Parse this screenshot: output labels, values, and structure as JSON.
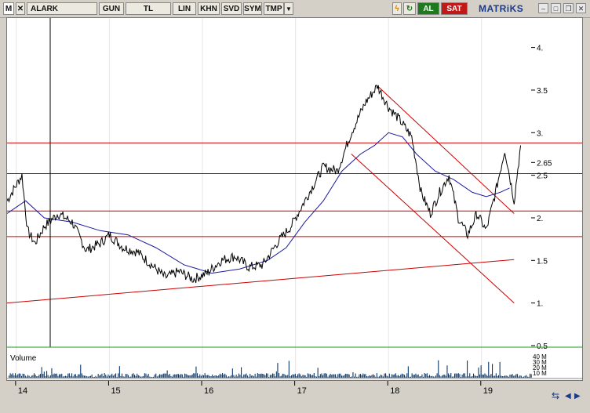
{
  "toolbar": {
    "m_label": "M",
    "symbol": "ALARK",
    "period": "GUN",
    "currency": "TL",
    "scale": "LIN",
    "khn": "KHN",
    "svd": "SVD",
    "sym": "SYM",
    "tmp": "TMP",
    "buy": "AL",
    "sell": "SAT",
    "logo": "MATRiKS"
  },
  "colors": {
    "price": "#000000",
    "moving_average": "#1a1aa0",
    "trendline": "#cc0000",
    "volume": "#0b3a6e",
    "buy": "#1f7a1f",
    "sell": "#c21818"
  },
  "chart_data": {
    "type": "line",
    "title": "",
    "y_ticks": [
      4,
      3.5,
      3,
      2.65,
      2.5,
      2,
      1.5,
      1,
      0.5
    ],
    "y_tick_labels": [
      "4.",
      "3.5",
      "3.",
      "2.65",
      "2.5",
      "2.",
      "1.5",
      "1.",
      "0.5"
    ],
    "ylim": [
      0.5,
      4.3
    ],
    "x_ticks": [
      "14",
      "15",
      "16",
      "17",
      "18",
      "19"
    ],
    "xlim": [
      2013.9,
      2019.55
    ],
    "price_points": [
      [
        2013.9,
        2.2
      ],
      [
        2013.98,
        2.35
      ],
      [
        2014.06,
        2.5
      ],
      [
        2014.12,
        1.85
      ],
      [
        2014.2,
        1.7
      ],
      [
        2014.3,
        1.9
      ],
      [
        2014.45,
        2.05
      ],
      [
        2014.6,
        1.95
      ],
      [
        2014.75,
        1.62
      ],
      [
        2014.9,
        1.7
      ],
      [
        2015.0,
        1.8
      ],
      [
        2015.15,
        1.65
      ],
      [
        2015.3,
        1.6
      ],
      [
        2015.45,
        1.45
      ],
      [
        2015.6,
        1.3
      ],
      [
        2015.75,
        1.37
      ],
      [
        2015.9,
        1.28
      ],
      [
        2016.05,
        1.35
      ],
      [
        2016.2,
        1.5
      ],
      [
        2016.35,
        1.55
      ],
      [
        2016.5,
        1.42
      ],
      [
        2016.65,
        1.45
      ],
      [
        2016.8,
        1.7
      ],
      [
        2016.95,
        1.9
      ],
      [
        2017.05,
        2.1
      ],
      [
        2017.15,
        2.3
      ],
      [
        2017.3,
        2.6
      ],
      [
        2017.45,
        2.55
      ],
      [
        2017.6,
        3.0
      ],
      [
        2017.75,
        3.35
      ],
      [
        2017.88,
        3.55
      ],
      [
        2018.0,
        3.3
      ],
      [
        2018.12,
        3.15
      ],
      [
        2018.25,
        2.95
      ],
      [
        2018.35,
        2.3
      ],
      [
        2018.45,
        2.05
      ],
      [
        2018.55,
        2.3
      ],
      [
        2018.65,
        2.5
      ],
      [
        2018.75,
        2.0
      ],
      [
        2018.85,
        1.8
      ],
      [
        2018.95,
        2.05
      ],
      [
        2019.05,
        1.85
      ],
      [
        2019.15,
        2.3
      ],
      [
        2019.25,
        2.8
      ],
      [
        2019.35,
        2.2
      ],
      [
        2019.42,
        2.85
      ]
    ],
    "moving_average_points": [
      [
        2013.9,
        2.05
      ],
      [
        2014.1,
        2.2
      ],
      [
        2014.3,
        2.0
      ],
      [
        2014.6,
        1.95
      ],
      [
        2014.9,
        1.85
      ],
      [
        2015.2,
        1.8
      ],
      [
        2015.5,
        1.65
      ],
      [
        2015.8,
        1.45
      ],
      [
        2016.1,
        1.35
      ],
      [
        2016.4,
        1.4
      ],
      [
        2016.7,
        1.5
      ],
      [
        2016.9,
        1.65
      ],
      [
        2017.1,
        1.95
      ],
      [
        2017.3,
        2.2
      ],
      [
        2017.5,
        2.55
      ],
      [
        2017.7,
        2.75
      ],
      [
        2017.85,
        2.85
      ],
      [
        2018.0,
        3.0
      ],
      [
        2018.15,
        2.95
      ],
      [
        2018.3,
        2.75
      ],
      [
        2018.5,
        2.55
      ],
      [
        2018.7,
        2.45
      ],
      [
        2018.9,
        2.3
      ],
      [
        2019.05,
        2.25
      ],
      [
        2019.2,
        2.3
      ],
      [
        2019.3,
        2.35
      ]
    ],
    "horizontal_levels": [
      2.88,
      2.52,
      2.08,
      1.78
    ],
    "trendlines": [
      [
        [
          2013.9,
          1.0
        ],
        [
          2019.35,
          1.51
        ]
      ],
      [
        [
          2017.6,
          2.75
        ],
        [
          2019.35,
          1.0
        ]
      ],
      [
        [
          2017.88,
          3.55
        ],
        [
          2019.35,
          2.05
        ]
      ]
    ],
    "volume_label": "Volume",
    "volume_tick_labels": [
      "40 M",
      "30 M",
      "20 M",
      "10 M"
    ],
    "volume_ylim": [
      0,
      40
    ]
  }
}
